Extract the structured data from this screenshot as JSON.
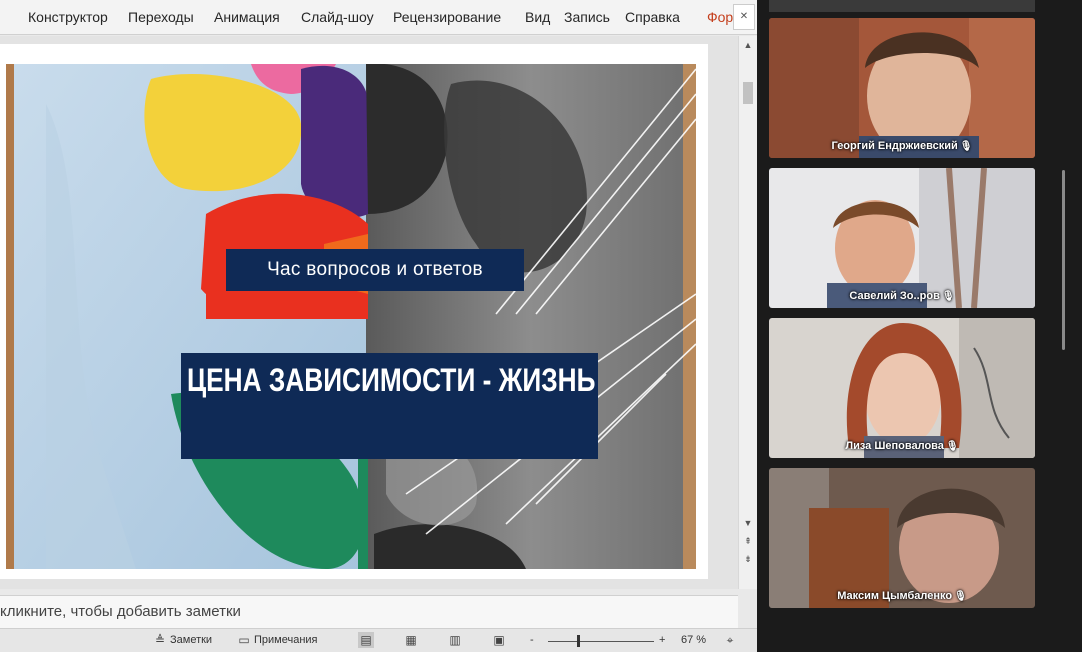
{
  "ribbon": {
    "tabs": [
      "Конструктор",
      "Переходы",
      "Анимация",
      "Слайд-шоу",
      "Рецензирование",
      "Вид",
      "Запись",
      "Справка",
      "Фор"
    ]
  },
  "slide": {
    "subtitle": "Час вопросов и ответов",
    "title": "ЦЕНА ЗАВИСИМОСТИ - ЖИЗНЬ"
  },
  "notes": {
    "placeholder": "кликните, чтобы добавить заметки"
  },
  "statusbar": {
    "notes_label": "Заметки",
    "comments_label": "Примечания",
    "zoom_minus": "-",
    "zoom_plus": "+",
    "zoom_level": "67 %"
  },
  "conference": {
    "top_partial": "",
    "participants": [
      {
        "name": "Георгий Ендржиевский"
      },
      {
        "name": "Савелий Зо..ров"
      },
      {
        "name": "Лиза Шеповалова"
      },
      {
        "name": "Максим Цымбаленко"
      }
    ]
  },
  "colors": {
    "slide_box": "#0f2a56",
    "active_tab": "#c43e1c"
  }
}
